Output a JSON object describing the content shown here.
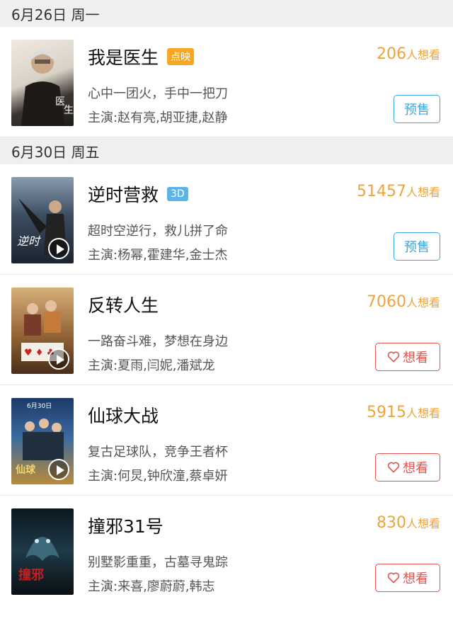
{
  "sections": [
    {
      "date": "6月26日 周一",
      "movies": [
        {
          "title": "我是医生",
          "tag": "点映",
          "tag_color": "#f5a623",
          "count": "206",
          "unit": "人想看",
          "slogan": "心中一团火，手中一把刀",
          "cast": "主演:赵有亮,胡亚捷,赵静",
          "button": "预售",
          "poster_colors": [
            "#e9e4dc",
            "#3a3530"
          ],
          "has_play": false
        }
      ]
    },
    {
      "date": "6月30日 周五",
      "movies": [
        {
          "title": "逆时营救",
          "tag": "3D",
          "tag_color": "#5ab4e8",
          "count": "51457",
          "unit": "人想看",
          "slogan": "超时空逆行，救儿拼了命",
          "cast": "主演:杨幂,霍建华,金士杰",
          "button": "预售",
          "poster_colors": [
            "#2b3a4a",
            "#6b7c8e"
          ],
          "has_play": true
        },
        {
          "title": "反转人生",
          "tag": "",
          "count": "7060",
          "unit": "人想看",
          "slogan": "一路奋斗难，梦想在身边",
          "cast": "主演:夏雨,闫妮,潘斌龙",
          "button": "想看",
          "poster_colors": [
            "#b8874a",
            "#5a3a20"
          ],
          "has_play": true
        },
        {
          "title": "仙球大战",
          "tag": "",
          "count": "5915",
          "unit": "人想看",
          "slogan": "复古足球队，竞争王者杯",
          "cast": "主演:何炅,钟欣潼,蔡卓妍",
          "button": "想看",
          "poster_colors": [
            "#2c4f7a",
            "#c9a24a"
          ],
          "has_play": true
        },
        {
          "title": "撞邪31号",
          "tag": "",
          "count": "830",
          "unit": "人想看",
          "slogan": "别墅影重重，古墓寻鬼踪",
          "cast": "主演:来喜,廖蔚蔚,韩志",
          "button": "想看",
          "poster_colors": [
            "#0d1a22",
            "#2a4a5a"
          ],
          "has_play": false
        }
      ]
    }
  ]
}
